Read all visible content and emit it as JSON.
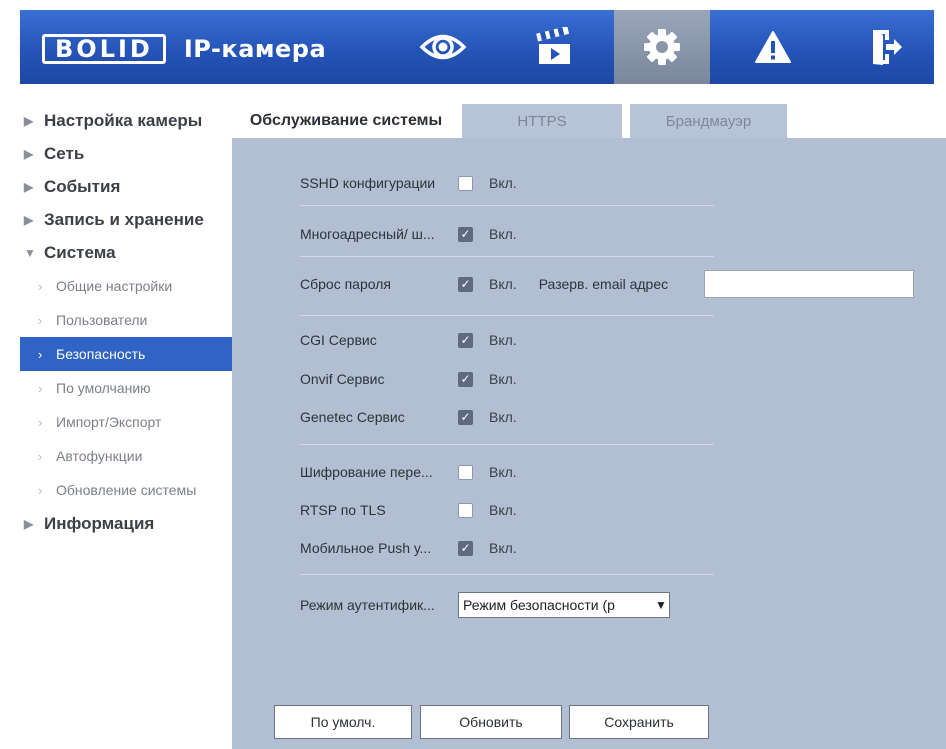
{
  "header": {
    "logo": "BOLID",
    "title": "IP-камера",
    "nav": [
      {
        "icon": "eye-icon"
      },
      {
        "icon": "clapperboard-icon"
      },
      {
        "icon": "gear-icon",
        "active": true
      },
      {
        "icon": "warning-icon"
      },
      {
        "icon": "logout-icon"
      }
    ]
  },
  "sidebar": {
    "items": [
      {
        "label": "Настройка камеры"
      },
      {
        "label": "Сеть"
      },
      {
        "label": "События"
      },
      {
        "label": "Запись и хранение"
      },
      {
        "label": "Система",
        "expanded": true
      },
      {
        "label": "Информация"
      }
    ],
    "system_sub": [
      {
        "label": "Общие настройки"
      },
      {
        "label": "Пользователи"
      },
      {
        "label": "Безопасность",
        "active": true
      },
      {
        "label": "По умолчанию"
      },
      {
        "label": "Импорт/Экспорт"
      },
      {
        "label": "Автофункции"
      },
      {
        "label": "Обновление системы"
      }
    ]
  },
  "tabs": [
    {
      "label": "Обслуживание системы",
      "active": true
    },
    {
      "label": "HTTPS"
    },
    {
      "label": "Брандмауэр"
    }
  ],
  "form": {
    "on_label": "Вкл.",
    "rows": [
      {
        "label": "SSHD конфигурации",
        "checked": false
      },
      {
        "label": "Многоадресный/ ш...",
        "checked": true
      },
      {
        "label": "Сброс пароля",
        "checked": true,
        "extra": "Разерв. email адрес"
      },
      {
        "label": "CGI Сервис",
        "checked": true
      },
      {
        "label": "Onvif Сервис",
        "checked": true
      },
      {
        "label": "Genetec Сервис",
        "checked": true
      },
      {
        "label": "Шифрование пере...",
        "checked": false
      },
      {
        "label": "RTSP по TLS",
        "checked": false
      },
      {
        "label": "Мобильное Push у...",
        "checked": true
      }
    ],
    "email_value": "",
    "auth_label": "Режим аутентифик...",
    "auth_value": "Режим безопасности (р"
  },
  "buttons": {
    "default": "По умолч.",
    "refresh": "Обновить",
    "save": "Сохранить"
  },
  "colors": {
    "header_blue": "#2554b8",
    "panel": "#b2bfd2",
    "active_menu": "#2f64c4"
  }
}
